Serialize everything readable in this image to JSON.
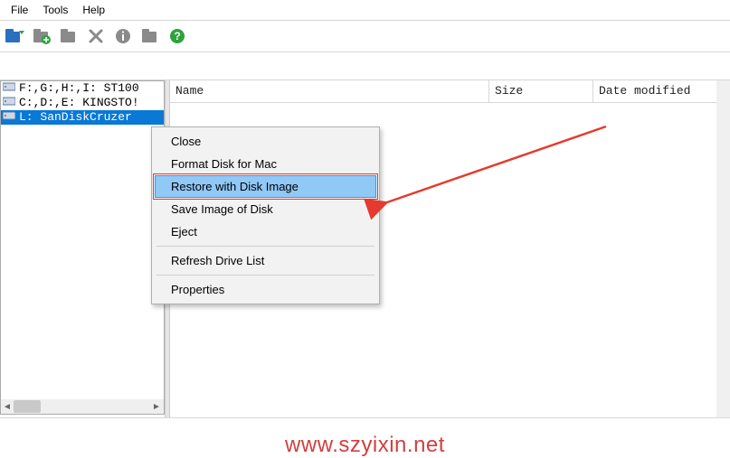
{
  "menu": {
    "file": "File",
    "tools": "Tools",
    "help": "Help"
  },
  "toolbar_icons": {
    "open": "open-icon",
    "add": "add-folder-icon",
    "folder": "folder-icon",
    "delete": "delete-icon",
    "info": "info-icon",
    "folder2": "folder2-icon",
    "help": "help-icon"
  },
  "left_pane": {
    "drives": [
      {
        "label": "F:,G:,H:,I: ST100"
      },
      {
        "label": "C:,D:,E: KINGSTO!"
      },
      {
        "label": "L: SanDiskCruzer",
        "selected": true
      }
    ]
  },
  "columns": {
    "name": "Name",
    "size": "Size",
    "date": "Date modified"
  },
  "context_menu": {
    "close": "Close",
    "format": "Format Disk for Mac",
    "restore": "Restore with Disk Image",
    "save": "Save Image of Disk",
    "eject": "Eject",
    "refresh": "Refresh Drive List",
    "properties": "Properties"
  },
  "watermark": "www.szyixin.net"
}
